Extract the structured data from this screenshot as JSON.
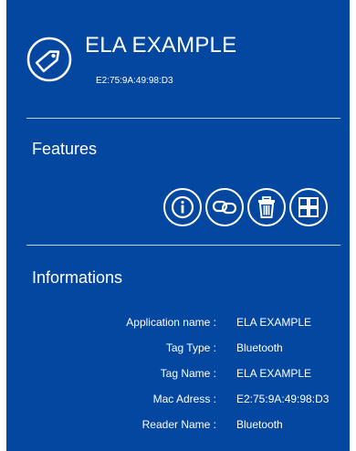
{
  "header": {
    "title": "ELA EXAMPLE",
    "mac": "E2:75:9A:49:98:D3",
    "logo_icon": "tag-icon"
  },
  "features": {
    "title": "Features",
    "buttons": [
      {
        "icon": "info-icon"
      },
      {
        "icon": "link-icon"
      },
      {
        "icon": "trash-icon"
      },
      {
        "icon": "grid-icon"
      }
    ]
  },
  "informations": {
    "title": "Informations",
    "rows": [
      {
        "label": "Application name :",
        "value": "ELA EXAMPLE"
      },
      {
        "label": "Tag Type :",
        "value": "Bluetooth"
      },
      {
        "label": "Tag Name :",
        "value": "ELA EXAMPLE"
      },
      {
        "label": "Mac Adress :",
        "value": "E2:75:9A:49:98:D3"
      },
      {
        "label": "Reader Name :",
        "value": "Bluetooth"
      }
    ]
  },
  "colors": {
    "background": "#0447a1",
    "foreground": "#ffffff"
  }
}
